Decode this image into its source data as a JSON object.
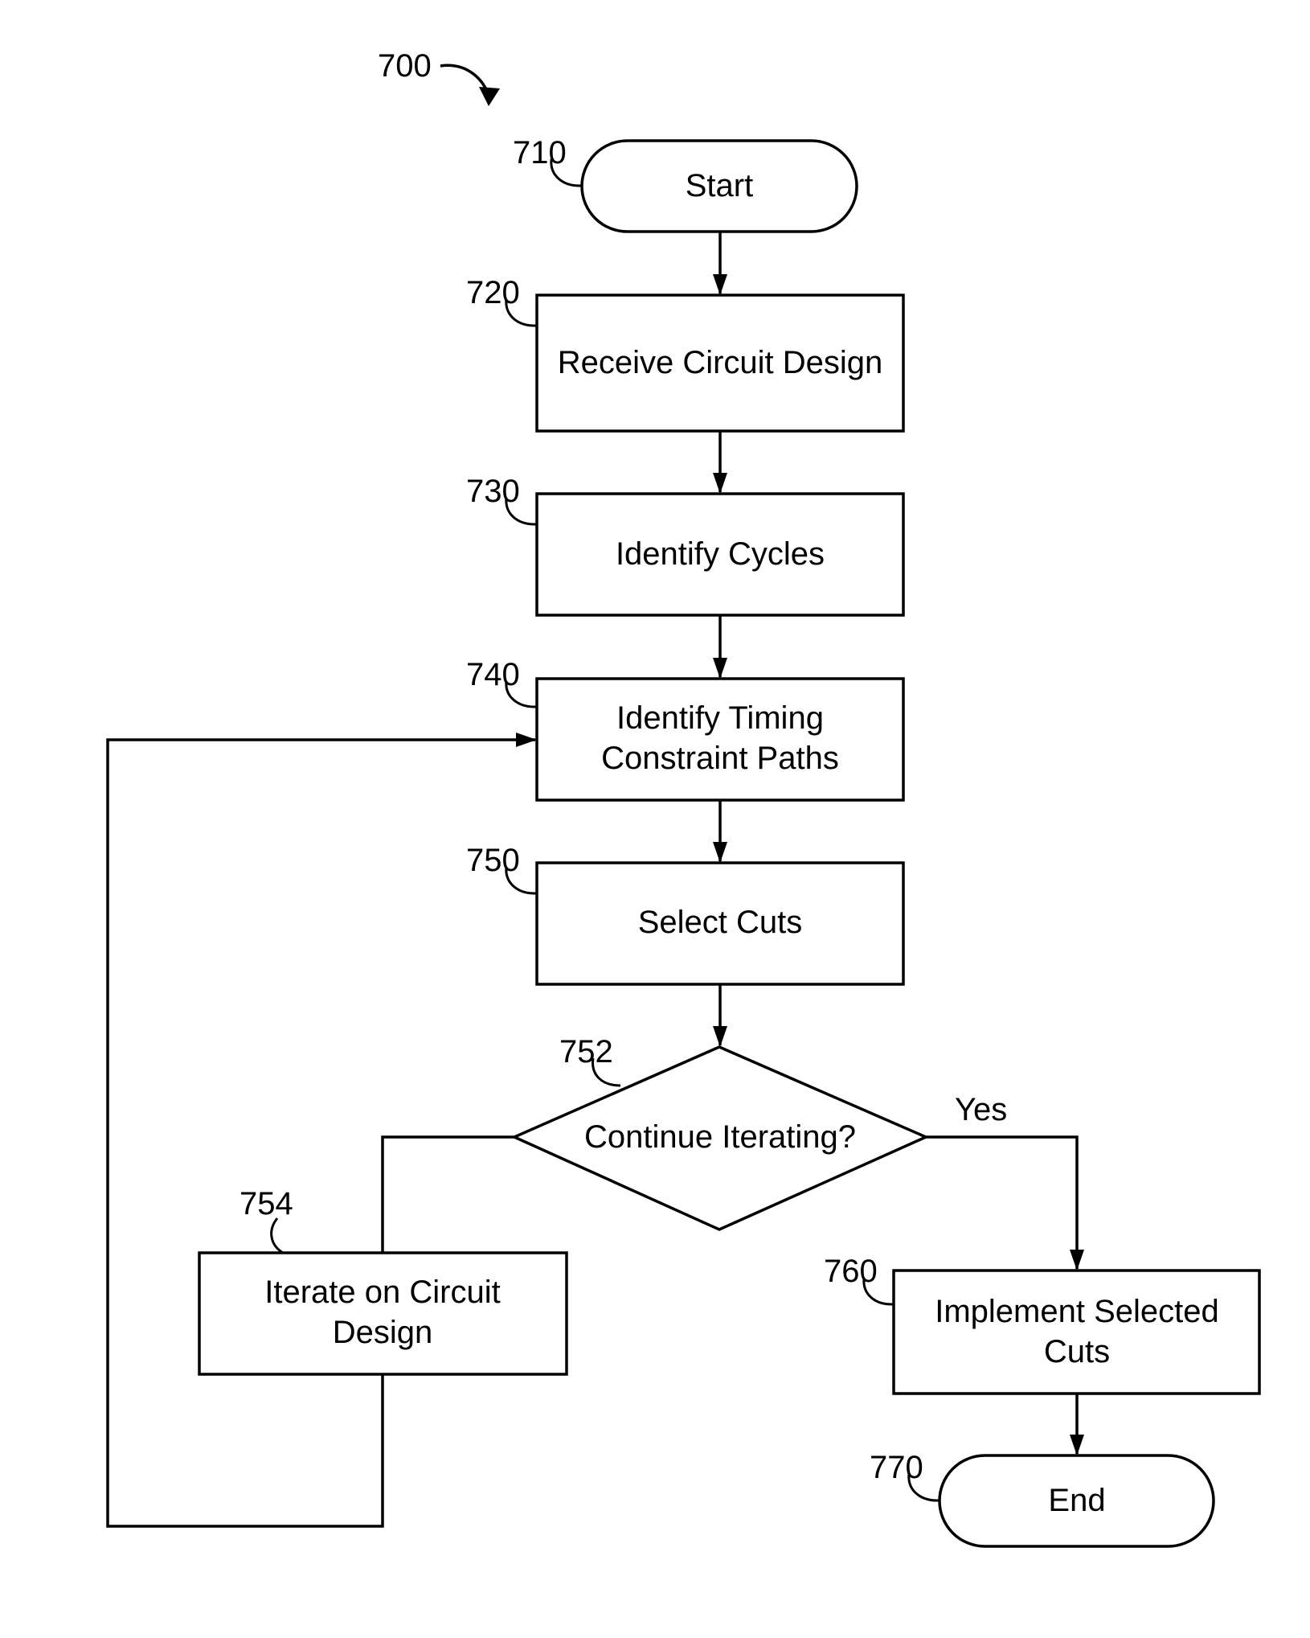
{
  "figure": {
    "ref": "700",
    "nodes": [
      {
        "id": "710",
        "type": "terminal",
        "lines": [
          "Start"
        ]
      },
      {
        "id": "720",
        "type": "process",
        "lines": [
          "Receive Circuit Design"
        ]
      },
      {
        "id": "730",
        "type": "process",
        "lines": [
          "Identify Cycles"
        ]
      },
      {
        "id": "740",
        "type": "process",
        "lines": [
          "Identify Timing",
          "Constraint Paths"
        ]
      },
      {
        "id": "750",
        "type": "process",
        "lines": [
          "Select Cuts"
        ]
      },
      {
        "id": "752",
        "type": "decision",
        "lines": [
          "Continue Iterating?"
        ]
      },
      {
        "id": "754",
        "type": "process",
        "lines": [
          "Iterate on Circuit",
          "Design"
        ]
      },
      {
        "id": "760",
        "type": "process",
        "lines": [
          "Implement Selected",
          "Cuts"
        ]
      },
      {
        "id": "770",
        "type": "terminal",
        "lines": [
          "End"
        ]
      }
    ],
    "edges": [
      {
        "from": "710",
        "to": "720"
      },
      {
        "from": "720",
        "to": "730"
      },
      {
        "from": "730",
        "to": "740"
      },
      {
        "from": "740",
        "to": "750"
      },
      {
        "from": "750",
        "to": "752"
      },
      {
        "from": "752",
        "to": "760",
        "label": "Yes"
      },
      {
        "from": "752",
        "to": "754",
        "label": ""
      },
      {
        "from": "754",
        "to": "740"
      },
      {
        "from": "760",
        "to": "770"
      }
    ]
  }
}
